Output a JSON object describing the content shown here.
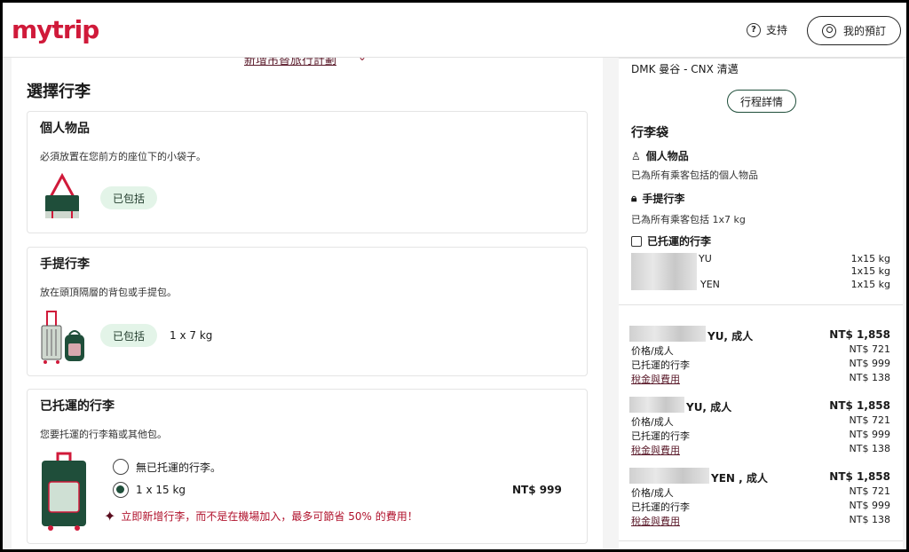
{
  "header": {
    "logo": "mytrip",
    "support_label": "支持",
    "my_booking_label": "我的預訂"
  },
  "left": {
    "cut_link": "新增吊替旅行計劃",
    "section_title": "選擇行李",
    "personal": {
      "title": "個人物品",
      "desc": "必須放置在您前方的座位下的小袋子。",
      "badge": "已包括"
    },
    "carry_on": {
      "title": "手提行李",
      "desc": "放在頭頂隔層的背包或手提包。",
      "badge": "已包括",
      "weight": "1 x 7 kg"
    },
    "checked": {
      "title": "已托運的行李",
      "desc": "您要托運的行李箱或其他包。",
      "option_none": "無已托運的行李。",
      "option_one": "1 x 15 kg",
      "option_one_price": "NT$ 999",
      "promo": "立即新增行李，而不是在機場加入，最多可節省 50% 的費用！"
    }
  },
  "right": {
    "route": "DMK 曼谷 - CNX 清邁",
    "details_button": "行程詳情",
    "bags_title": "行李袋",
    "personal_title": "個人物品",
    "personal_desc": "已為所有乘客包括的個人物品",
    "carry_title": "手提行李",
    "carry_desc": "已為所有乘客包括 1x7 kg",
    "checked_title": "已托運的行李",
    "checked_rows": [
      {
        "name": "YU",
        "weight": "1x15 kg"
      },
      {
        "name": "",
        "weight": "1x15 kg"
      },
      {
        "name": "YEN",
        "weight": "1x15 kg"
      }
    ],
    "passengers": [
      {
        "name": "YU, 成人",
        "total": "NT$ 1,858",
        "fare_label": "价格/成人",
        "fare": "NT$ 721",
        "bag_label": "已托運的行李",
        "bag": "NT$ 999",
        "tax_label": "稅金與費用",
        "tax": "NT$ 138"
      },
      {
        "name": "YU, 成人",
        "total": "NT$ 1,858",
        "fare_label": "价格/成人",
        "fare": "NT$ 721",
        "bag_label": "已托運的行李",
        "bag": "NT$ 999",
        "tax_label": "稅金與費用",
        "tax": "NT$ 138"
      },
      {
        "name": "YEN , 成人",
        "total": "NT$ 1,858",
        "fare_label": "价格/成人",
        "fare": "NT$ 721",
        "bag_label": "已托運的行李",
        "bag": "NT$ 999",
        "tax_label": "稅金與費用",
        "tax": "NT$ 138"
      }
    ]
  },
  "colors": {
    "brand": "#d01a3a",
    "accent_green": "#1f4e3a",
    "pill_bg": "#e3f4e8",
    "promo": "#b0122c"
  }
}
